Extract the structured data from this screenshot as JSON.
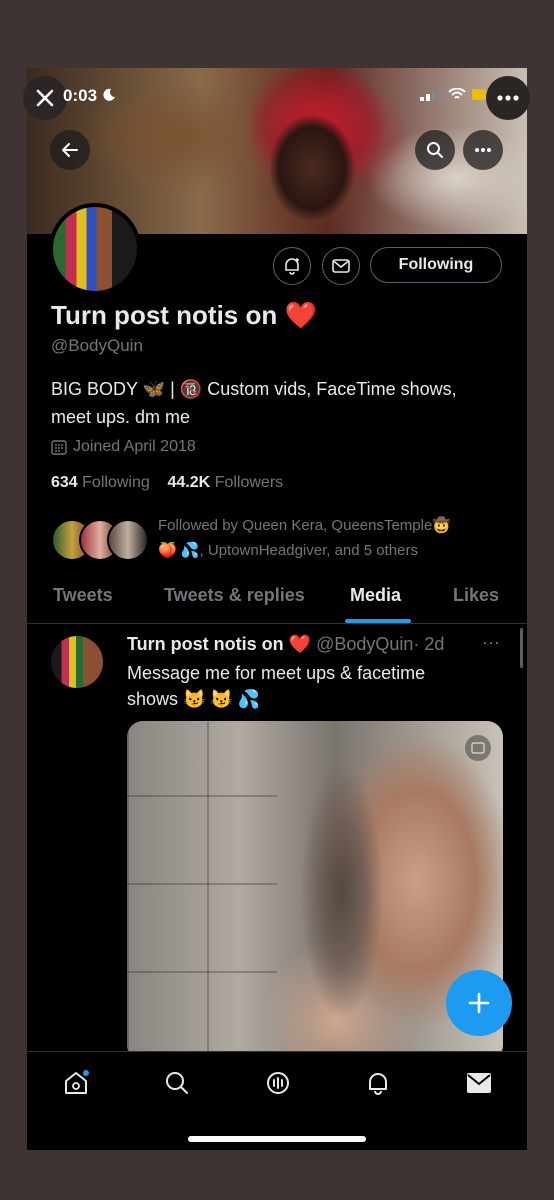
{
  "status_bar": {
    "time": "0:03"
  },
  "profile": {
    "display_name": "Turn post notis on",
    "name_emoji": "❤️",
    "handle": "@BodyQuin",
    "bio_line1": "BIG BODY 🦋 | 🔞 Custom vids, FaceTime shows,",
    "bio_line2": "meet ups. dm me",
    "joined": "Joined April 2018",
    "following_count": "634",
    "following_label": "Following",
    "followers_count": "44.2K",
    "followers_label": "Followers",
    "followed_by_line1": "Followed by Queen Kera, QueensTemple🤠",
    "followed_by_line2": "🍑 💦, UptownHeadgiver, and 5 others",
    "follow_button": "Following"
  },
  "tabs": [
    {
      "label": "Tweets"
    },
    {
      "label": "Tweets & replies"
    },
    {
      "label": "Media"
    },
    {
      "label": "Likes"
    }
  ],
  "active_tab": "Media",
  "tweet": {
    "author": "Turn post notis on",
    "author_emoji": "❤️",
    "handle": "@BodyQuin",
    "time": "· 2d",
    "more": "···",
    "text_line1": "Message me for meet ups & facetime",
    "text_line2": "shows 😼 😼 💦"
  },
  "colors": {
    "accent": "#1d9bf0",
    "background": "#000000",
    "muted": "#71767b",
    "text": "#e7e9ea",
    "frame": "#3d3433"
  },
  "icons": [
    "close-icon",
    "more-icon",
    "back-icon",
    "search-icon",
    "notify-bell-icon",
    "mail-icon",
    "calendar-icon",
    "compose-icon",
    "home-icon",
    "spaces-icon",
    "bell-icon",
    "messages-icon"
  ]
}
